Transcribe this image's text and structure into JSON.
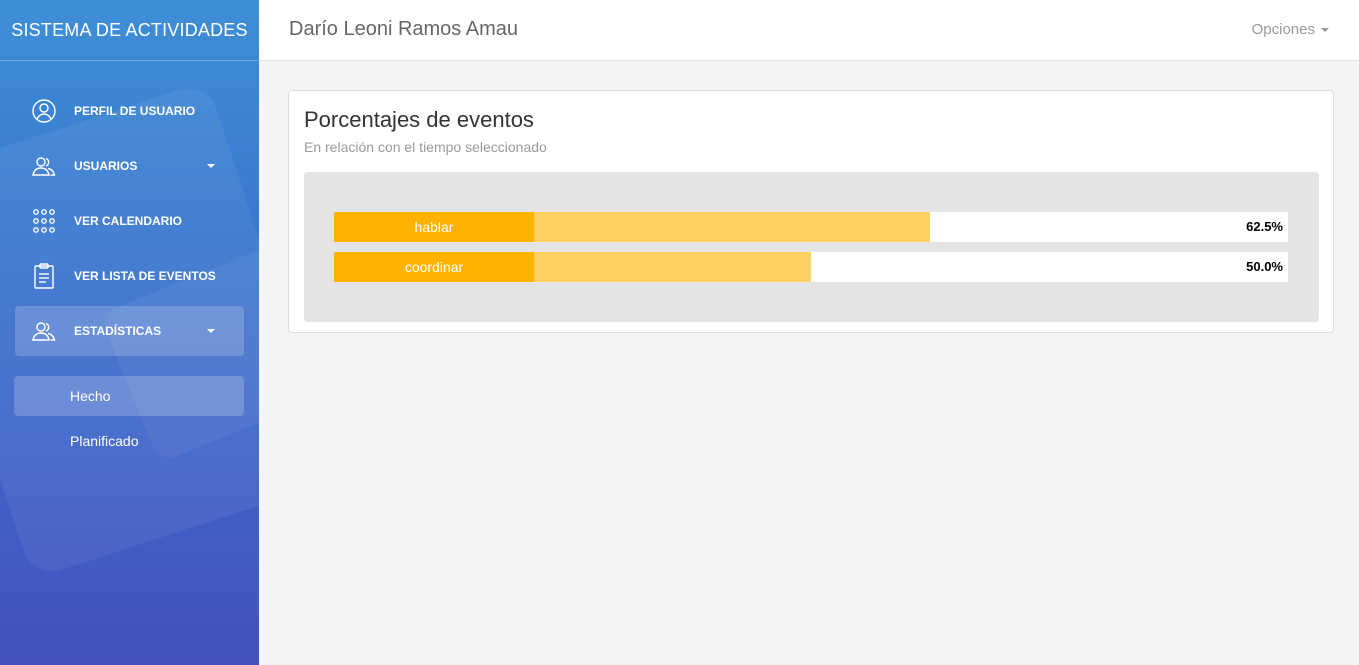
{
  "sidebar": {
    "brand": "SISTEMA DE ACTIVIDADES",
    "items": [
      {
        "label": "PERFIL DE USUARIO",
        "icon": "user-circle-icon"
      },
      {
        "label": "USUARIOS",
        "icon": "users-icon"
      },
      {
        "label": "VER CALENDARIO",
        "icon": "grid-dots-icon"
      },
      {
        "label": "VER LISTA DE EVENTOS",
        "icon": "clipboard-list-icon"
      },
      {
        "label": "ESTADÍSTICAS",
        "icon": "users-icon"
      }
    ],
    "subitems": [
      {
        "label": "Hecho"
      },
      {
        "label": "Planificado"
      }
    ]
  },
  "header": {
    "user_name": "Darío Leoni Ramos Amau",
    "options_label": "Opciones"
  },
  "card": {
    "title": "Porcentajes de eventos",
    "subtitle": "En relación con el tiempo seleccionado"
  },
  "bars": [
    {
      "label": "hablar",
      "value_text": "62.5%",
      "value": 62.5
    },
    {
      "label": "coordinar",
      "value_text": "50.0%",
      "value": 50.0
    }
  ],
  "colors": {
    "bar_label": "#ffb300",
    "bar_fill": "#ffd163"
  }
}
